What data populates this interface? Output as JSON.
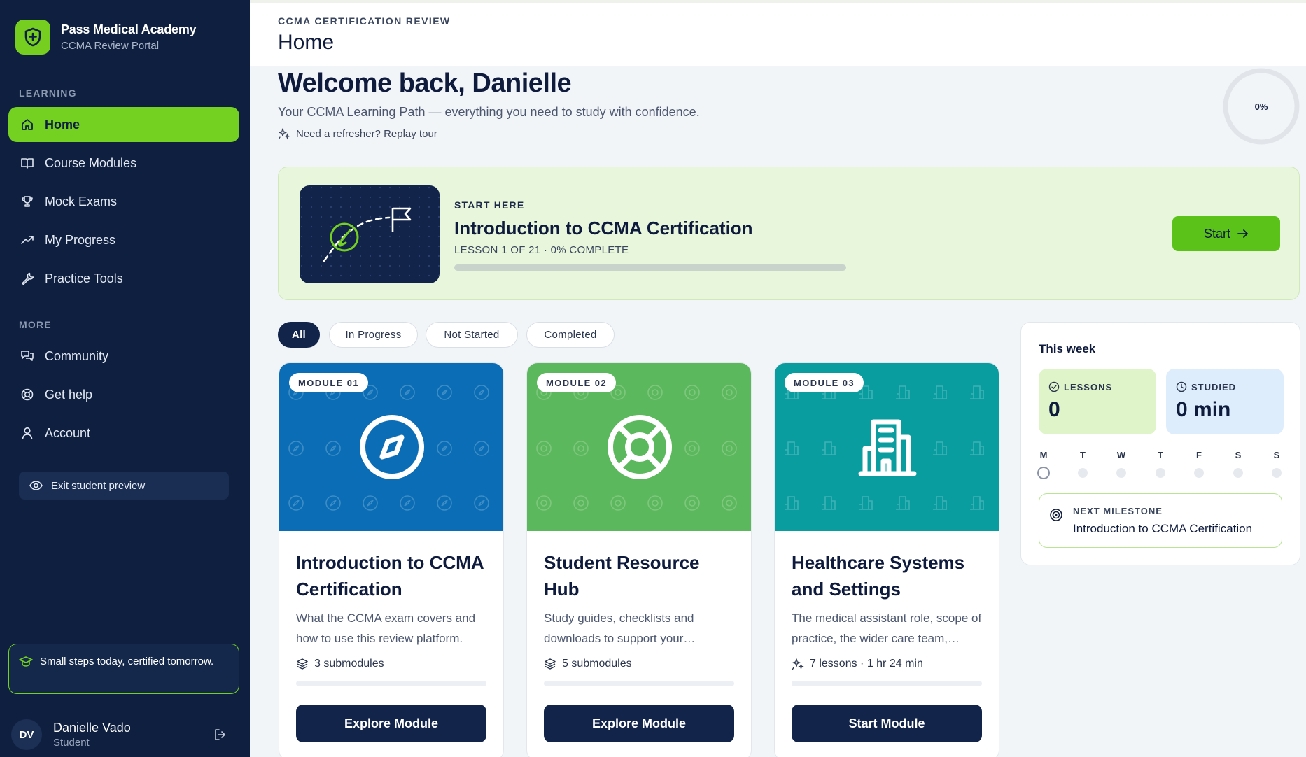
{
  "brand": {
    "name": "Pass Medical Academy",
    "subtitle": "CCMA Review Portal"
  },
  "sidebar": {
    "section_learning": "LEARNING",
    "learning_items": [
      {
        "label": "Home",
        "icon": "home-icon",
        "active": true
      },
      {
        "label": "Course Modules",
        "icon": "book-icon"
      },
      {
        "label": "Mock Exams",
        "icon": "trophy-icon"
      },
      {
        "label": "My Progress",
        "icon": "trending-up-icon"
      },
      {
        "label": "Practice Tools",
        "icon": "wrench-icon"
      }
    ],
    "section_more": "MORE",
    "more_items": [
      {
        "label": "Community",
        "icon": "chat-icon"
      },
      {
        "label": "Get help",
        "icon": "lifebuoy-icon"
      },
      {
        "label": "Account",
        "icon": "user-icon"
      }
    ],
    "preview_button": "Exit student preview",
    "tip": "Small steps today, certified tomorrow.",
    "user": {
      "initials": "DV",
      "name": "Danielle Vado",
      "role": "Student"
    }
  },
  "header": {
    "eyebrow": "CCMA CERTIFICATION REVIEW",
    "title": "Home"
  },
  "welcome": {
    "title": "Welcome back, Danielle",
    "subtitle": "Your CCMA Learning Path — everything you need to study with confidence.",
    "refresher": "Need a refresher? Replay tour",
    "overall_progress": "0%"
  },
  "hero": {
    "eyebrow": "START HERE",
    "title": "Introduction to CCMA Certification",
    "meta": "LESSON 1 OF 21 · 0% COMPLETE",
    "progress": 0,
    "button": "Start"
  },
  "filters": [
    "All",
    "In Progress",
    "Not Started",
    "Completed"
  ],
  "modules": [
    {
      "badge": "MODULE 01",
      "title": "Introduction to CCMA Certification",
      "description": "What the CCMA exam covers and how to use this review platform.",
      "meta": "3 submodules",
      "button": "Explore Module",
      "color": "#0a6db5",
      "icon": "compass-icon",
      "progress": 0
    },
    {
      "badge": "MODULE 02",
      "title": "Student Resource Hub",
      "description": "Study guides, checklists and downloads to support your…",
      "meta": "5 submodules",
      "button": "Explore Module",
      "color": "#5cb85c",
      "icon": "lifebuoy-icon",
      "progress": 0
    },
    {
      "badge": "MODULE 03",
      "title": "Healthcare Systems and Settings",
      "description": "The medical assistant role, scope of practice, the wider care team,…",
      "meta": "7 lessons · 1 hr 24 min",
      "button": "Start Module",
      "color": "#0a9da0",
      "icon": "building-icon",
      "progress": 0
    }
  ],
  "week": {
    "title": "This week",
    "lessons_label": "LESSONS",
    "lessons_value": "0",
    "studied_label": "STUDIED",
    "studied_value": "0 min",
    "days": [
      "M",
      "T",
      "W",
      "T",
      "F",
      "S",
      "S"
    ],
    "milestone_label": "NEXT MILESTONE",
    "milestone_value": "Introduction to CCMA Certification"
  },
  "colors": {
    "sidebar": "#0f1f3f",
    "accent": "#74d021",
    "navy": "#12244a"
  }
}
